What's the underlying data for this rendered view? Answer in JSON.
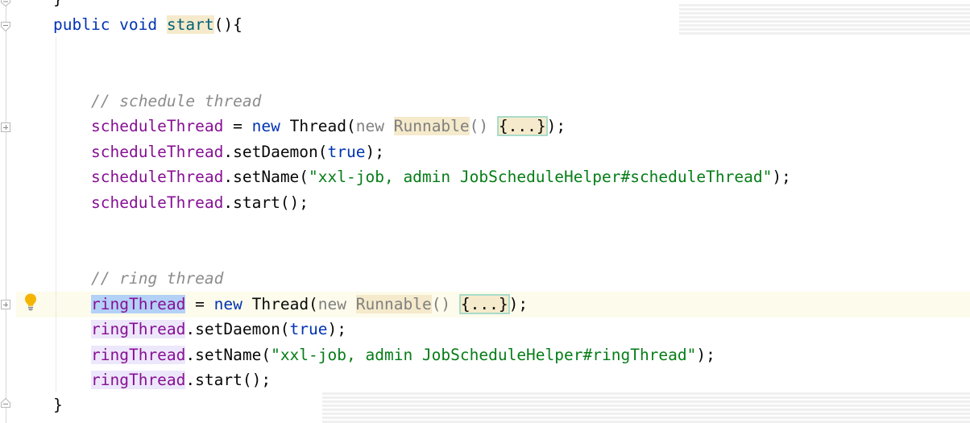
{
  "editor": {
    "language": "java",
    "colors": {
      "keyword": "#0033b3",
      "field": "#871094",
      "string": "#067d17",
      "comment": "#8c8c8c",
      "method_highlight_bg": "#f5eacb",
      "identifier_highlight_bg": "#b3d1f7",
      "current_line_bg": "#fdfbeb"
    },
    "icons": {
      "intention": "lightbulb-icon",
      "fold": "fold-icon",
      "unfold": "unfold-icon"
    },
    "lines": {
      "top_brace": "}",
      "method_sig": {
        "kw": "public void ",
        "name": "start",
        "rest": "(){"
      },
      "comment_schedule": "// schedule thread",
      "schedule_decl": {
        "field": "scheduleThread",
        "eq": " = ",
        "kw_new": "new",
        "type": " Thread(",
        "new2": "new ",
        "runnable": "Runnable",
        "parens": "() ",
        "folded": "{...}",
        "tail": ");"
      },
      "schedule_daemon": {
        "field": "scheduleThread",
        "call": ".setDaemon(",
        "arg": "true",
        "tail": ");"
      },
      "schedule_name": {
        "field": "scheduleThread",
        "call": ".setName(",
        "arg": "\"xxl-job, admin JobScheduleHelper#scheduleThread\"",
        "tail": ");"
      },
      "schedule_start": {
        "field": "scheduleThread",
        "call": ".start();"
      },
      "comment_ring": "// ring thread",
      "ring_decl": {
        "field": "ringThread",
        "eq": " = ",
        "kw_new": "new",
        "type": " Thread(",
        "new2": "new ",
        "runnable": "Runnable",
        "parens": "() ",
        "folded": "{...}",
        "tail": ");"
      },
      "ring_daemon": {
        "field": "ringThread",
        "call": ".setDaemon(",
        "arg": "true",
        "tail": ");"
      },
      "ring_name": {
        "field": "ringThread",
        "call": ".setName(",
        "arg": "\"xxl-job, admin JobScheduleHelper#ringThread\"",
        "tail": ");"
      },
      "ring_start": {
        "field": "ringThread",
        "call": ".start();"
      },
      "close_brace": "}"
    }
  }
}
